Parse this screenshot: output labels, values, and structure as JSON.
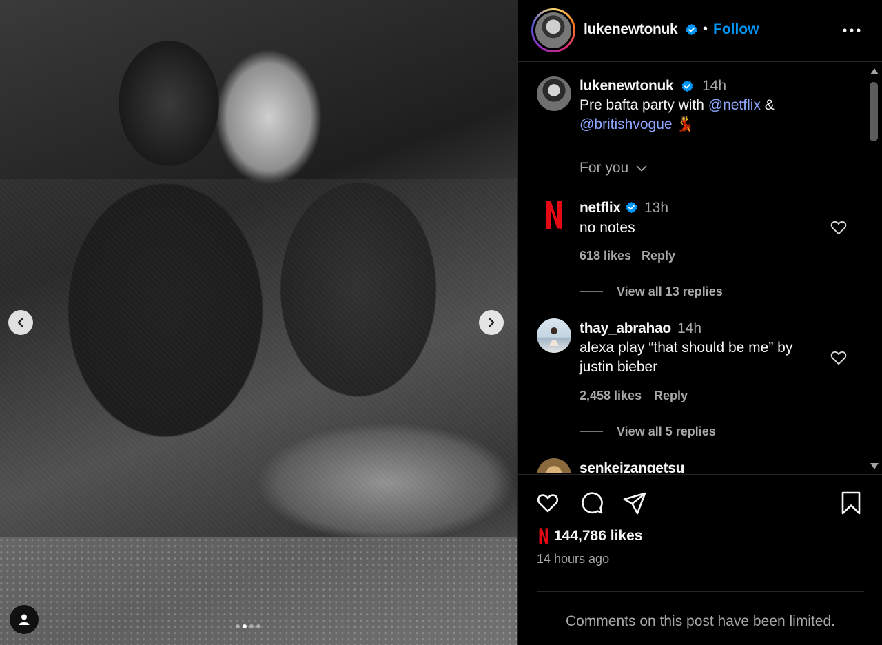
{
  "post": {
    "author": "lukenewtonuk",
    "separator": "•",
    "follow_label": "Follow",
    "caption_time": "14h",
    "caption_line1_prefix": "Pre bafta party with ",
    "caption_mention1": "@netflix",
    "caption_line1_suffix": " &",
    "caption_mention2": "@britishvogue",
    "caption_emoji": "💃",
    "for_you_label": "For you",
    "likes": "144,786 likes",
    "time_ago": "14 hours ago",
    "comments_limited": "Comments on this post have been limited."
  },
  "media": {
    "carousel_total": 4,
    "carousel_active": 2
  },
  "comments": [
    {
      "user": "netflix",
      "verified": true,
      "time": "13h",
      "text": "no notes",
      "likes": "618 likes",
      "reply_label": "Reply",
      "view_replies": "View all 13 replies"
    },
    {
      "user": "thay_abrahao",
      "verified": false,
      "time": "14h",
      "text": "alexa play “that should be me” by justin bieber",
      "likes": "2,458 likes",
      "reply_label": "Reply",
      "view_replies": "View all 5 replies"
    },
    {
      "user": "senkeizangetsu"
    }
  ],
  "colors": {
    "accent": "#0095f6",
    "mention": "#8fa7ff",
    "netflix_red": "#e50914",
    "secondary_text": "#a8a8a8"
  }
}
